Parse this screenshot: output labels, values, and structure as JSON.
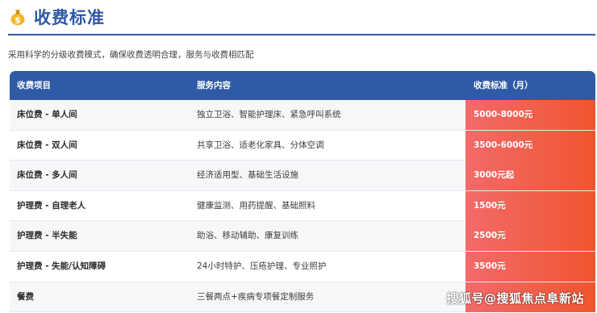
{
  "header": {
    "icon": "moneybag-icon",
    "title": "收费标准"
  },
  "intro": "采用科学的分级收费模式，确保收费透明合理，服务与收费相匹配",
  "table": {
    "columns": [
      "收费项目",
      "服务内容",
      "收费标准（月）"
    ],
    "rows": [
      {
        "item": "床位费 - 单人间",
        "service": "独立卫浴、智能护理床、紧急呼叫系统",
        "price": "5000-8000元"
      },
      {
        "item": "床位费 - 双人间",
        "service": "共享卫浴、适老化家具、分体空调",
        "price": "3500-6000元"
      },
      {
        "item": "床位费 - 多人间",
        "service": "经济适用型、基础生活设施",
        "price": "3000元起"
      },
      {
        "item": "护理费 - 自理老人",
        "service": "健康监测、用药提醒、基础照料",
        "price": "1500元"
      },
      {
        "item": "护理费 - 半失能",
        "service": "助浴、移动辅助、康复训练",
        "price": "2500元"
      },
      {
        "item": "护理费 - 失能/认知障碍",
        "service": "24小时特护、压疮护理、专业照护",
        "price": "3500元"
      },
      {
        "item": "餐费",
        "service": "三餐两点+疾病专项餐定制服务",
        "price": ""
      }
    ]
  },
  "colors": {
    "title": "#2f58a5",
    "header_bg": "#2f5ba6",
    "price_start": "#f36a6a",
    "price_end": "#f0552f"
  },
  "watermark": "搜狐号@搜狐焦点阜新站"
}
